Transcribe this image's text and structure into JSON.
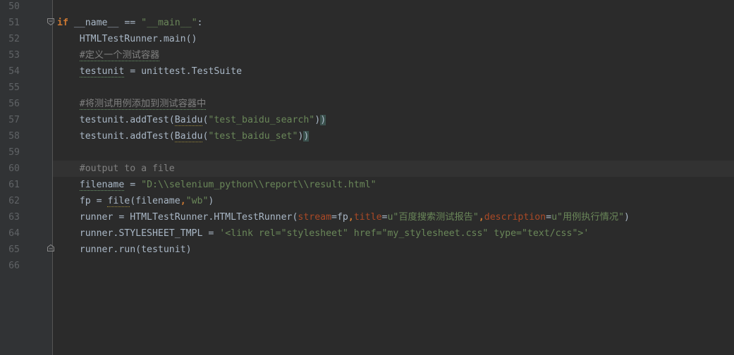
{
  "editor": {
    "lines": [
      {
        "num": "50",
        "parts": []
      },
      {
        "num": "51",
        "parts": [
          {
            "t": "if",
            "c": "kw"
          },
          {
            "t": " "
          },
          {
            "t": "__name__",
            "c": "dunder2"
          },
          {
            "t": " == "
          },
          {
            "t": "\"__main__\"",
            "c": "str"
          },
          {
            "t": ":"
          }
        ]
      },
      {
        "num": "52",
        "parts": [
          {
            "t": "    HTMLTestRunner.main()"
          }
        ]
      },
      {
        "num": "53",
        "parts": [
          {
            "t": "    "
          },
          {
            "t": "#定义一个测试容器",
            "c": "cm sqg"
          }
        ]
      },
      {
        "num": "54",
        "parts": [
          {
            "t": "    "
          },
          {
            "t": "testunit",
            "c": "sqg"
          },
          {
            "t": " = unittest.TestSuite"
          }
        ]
      },
      {
        "num": "55",
        "parts": []
      },
      {
        "num": "56",
        "parts": [
          {
            "t": "    "
          },
          {
            "t": "#将测试用例添加到测试容器中",
            "c": "cm sqg"
          }
        ]
      },
      {
        "num": "57",
        "parts": [
          {
            "t": "    testunit.addTest("
          },
          {
            "t": "Baidu",
            "c": "sq"
          },
          {
            "t": "("
          },
          {
            "t": "\"test_baidu_search\"",
            "c": "str"
          },
          {
            "t": ")"
          },
          {
            "t": ")",
            "c": "brace"
          }
        ]
      },
      {
        "num": "58",
        "parts": [
          {
            "t": "    testunit.addTest("
          },
          {
            "t": "Baidu",
            "c": "sq"
          },
          {
            "t": "("
          },
          {
            "t": "\"test_baidu_set\"",
            "c": "str"
          },
          {
            "t": ")"
          },
          {
            "t": ")",
            "c": "brace"
          }
        ]
      },
      {
        "num": "59",
        "parts": []
      },
      {
        "num": "60",
        "current": true,
        "parts": [
          {
            "t": "    "
          },
          {
            "t": "#output to a file",
            "c": "cm"
          }
        ]
      },
      {
        "num": "61",
        "parts": [
          {
            "t": "    "
          },
          {
            "t": "filename",
            "c": "sqg"
          },
          {
            "t": " = "
          },
          {
            "t": "\"D:\\\\selenium_python\\\\report\\\\result.html\"",
            "c": "str"
          }
        ]
      },
      {
        "num": "62",
        "parts": [
          {
            "t": "    fp = "
          },
          {
            "t": "file",
            "c": "sq"
          },
          {
            "t": "(filename"
          },
          {
            "t": ",",
            "c": "kw"
          },
          {
            "t": "\"wb\"",
            "c": "str"
          },
          {
            "t": ")"
          }
        ]
      },
      {
        "num": "63",
        "parts": [
          {
            "t": "    runner = HTMLTestRunner.HTMLTestRunner("
          },
          {
            "t": "stream",
            "c": "param"
          },
          {
            "t": "=fp"
          },
          {
            "t": ",",
            "c": "kw"
          },
          {
            "t": "title",
            "c": "param"
          },
          {
            "t": "="
          },
          {
            "t": "u\"百度搜索测试报告\"",
            "c": "str"
          },
          {
            "t": ",",
            "c": "kw"
          },
          {
            "t": "description",
            "c": "param"
          },
          {
            "t": "="
          },
          {
            "t": "u\"用例执行情况\"",
            "c": "str"
          },
          {
            "t": ")"
          }
        ]
      },
      {
        "num": "64",
        "parts": [
          {
            "t": "    runner.STYLESHEET_TMPL = "
          },
          {
            "t": "'<link rel=\"stylesheet\" href=\"my_stylesheet.css\" type=\"text/css\">'",
            "c": "str"
          }
        ]
      },
      {
        "num": "65",
        "parts": [
          {
            "t": "    runner.run(testunit)"
          }
        ]
      },
      {
        "num": "66",
        "parts": []
      }
    ]
  }
}
